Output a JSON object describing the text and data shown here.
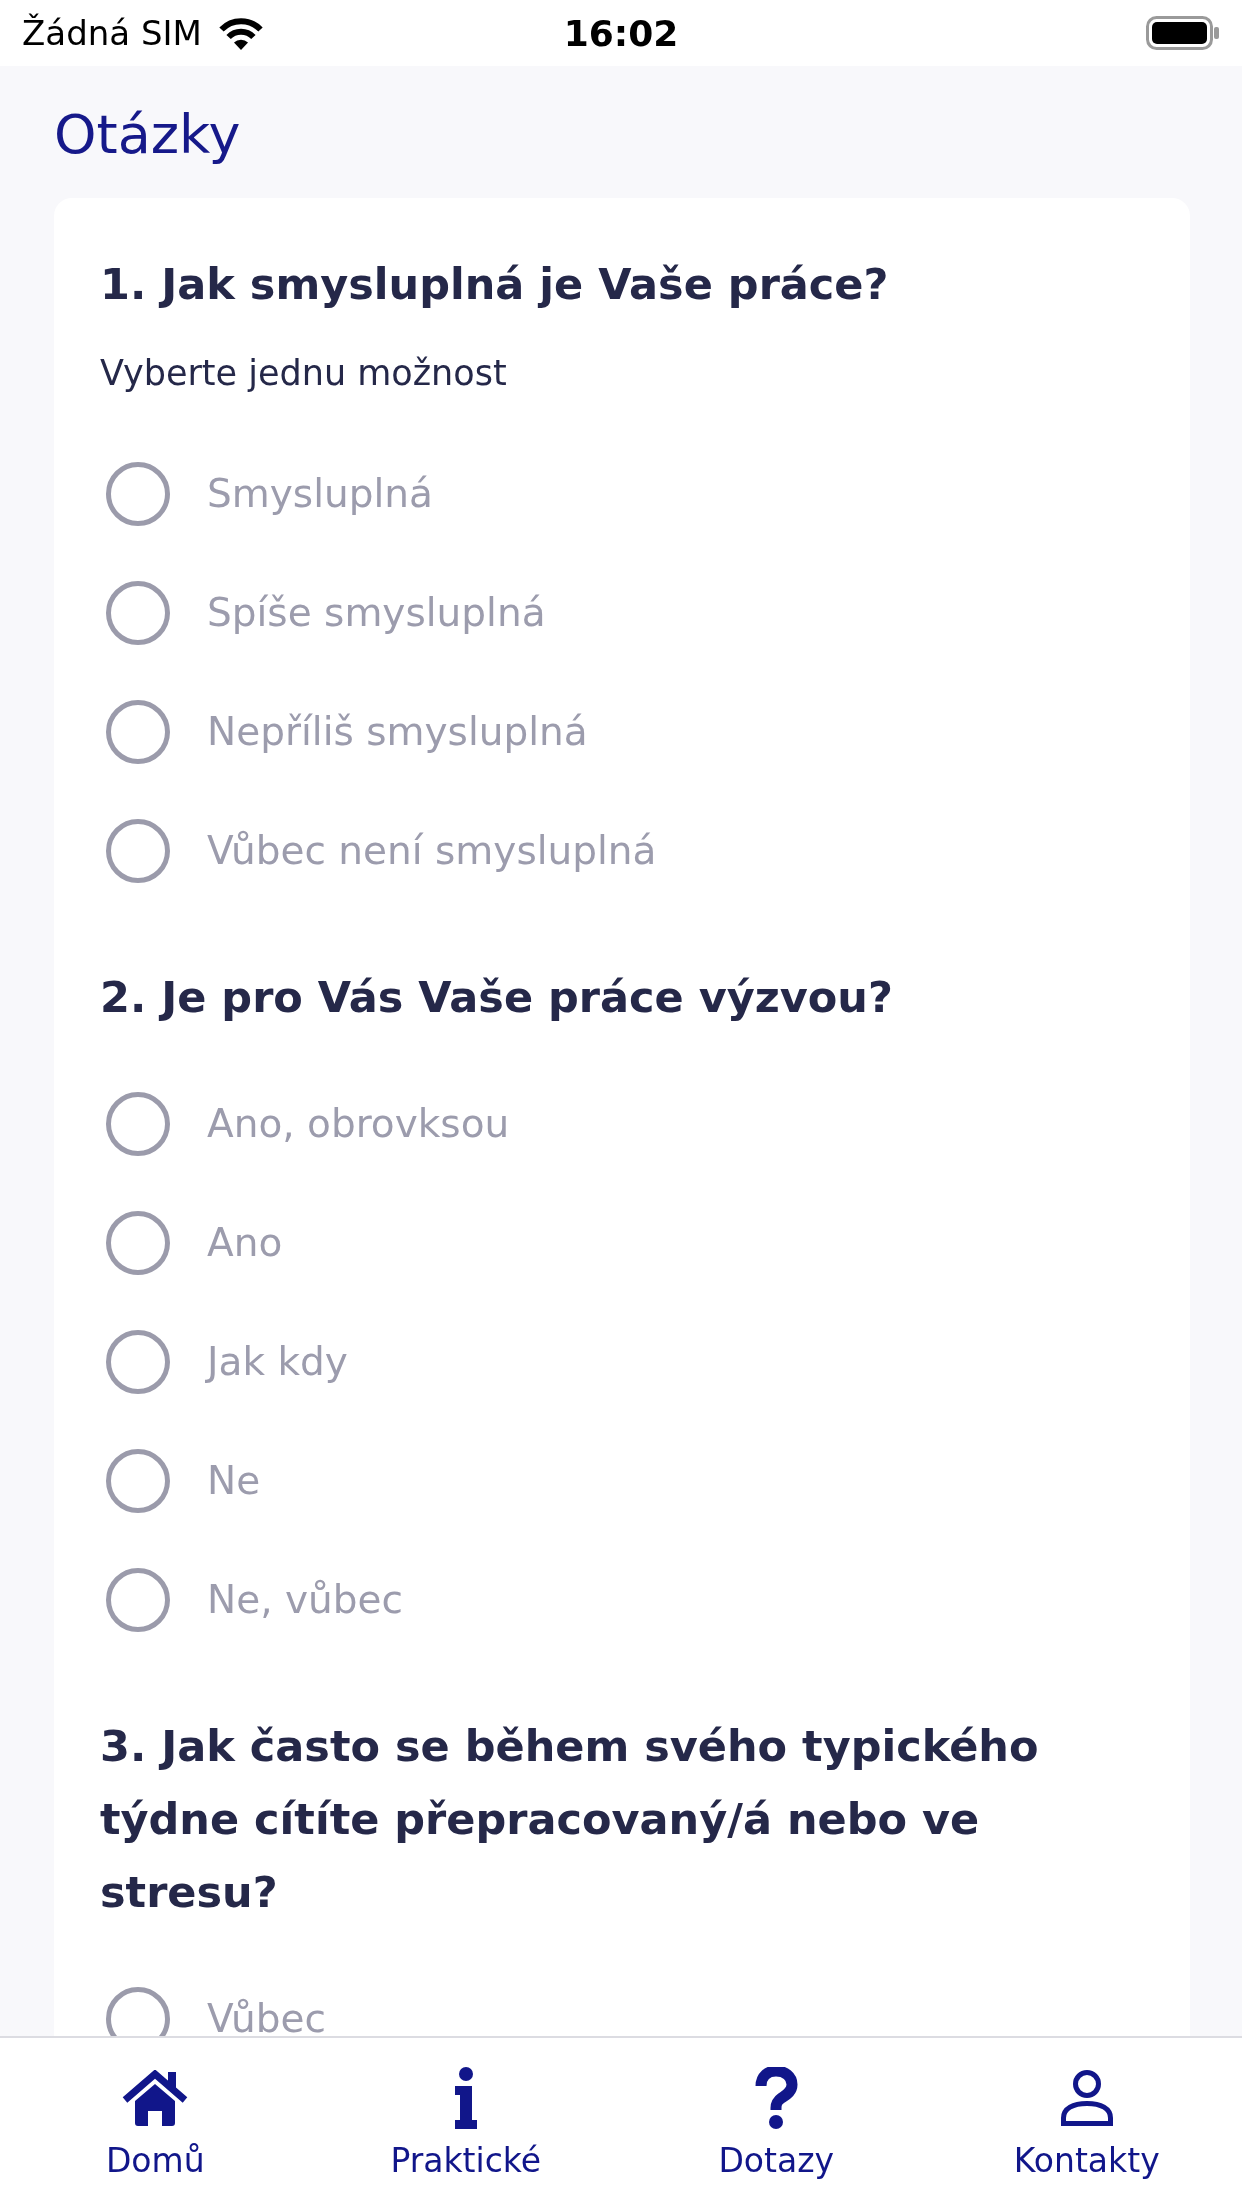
{
  "status_bar": {
    "carrier": "Žádná SIM",
    "time": "16:02"
  },
  "header": {
    "title": "Otázky"
  },
  "questions": [
    {
      "title": "1. Jak smysluplná je Vaše práce?",
      "hint": "Vyberte jednu možnost",
      "options": [
        {
          "label": "Smysluplná",
          "selected": false
        },
        {
          "label": "Spíše smysluplná",
          "selected": false
        },
        {
          "label": "Nepříliš smysluplná",
          "selected": false
        },
        {
          "label": "Vůbec není smysluplná",
          "selected": false
        }
      ]
    },
    {
      "title": "2. Je pro Vás Vaše práce výzvou?",
      "options": [
        {
          "label": "Ano, obrovksou",
          "selected": false
        },
        {
          "label": "Ano",
          "selected": false
        },
        {
          "label": "Jak kdy",
          "selected": false
        },
        {
          "label": "Ne",
          "selected": false
        },
        {
          "label": "Ne, vůbec",
          "selected": false
        }
      ]
    },
    {
      "title": "3. Jak často se během svého typického týdne cítíte přepracovaný/á nebo ve stresu?",
      "options": [
        {
          "label": "Vůbec",
          "selected": false
        }
      ]
    }
  ],
  "tab_bar": [
    {
      "label": "Domů",
      "kind": "home"
    },
    {
      "label": "Praktické",
      "kind": "info"
    },
    {
      "label": "Dotazy",
      "kind": "question"
    },
    {
      "label": "Kontakty",
      "kind": "person"
    }
  ]
}
